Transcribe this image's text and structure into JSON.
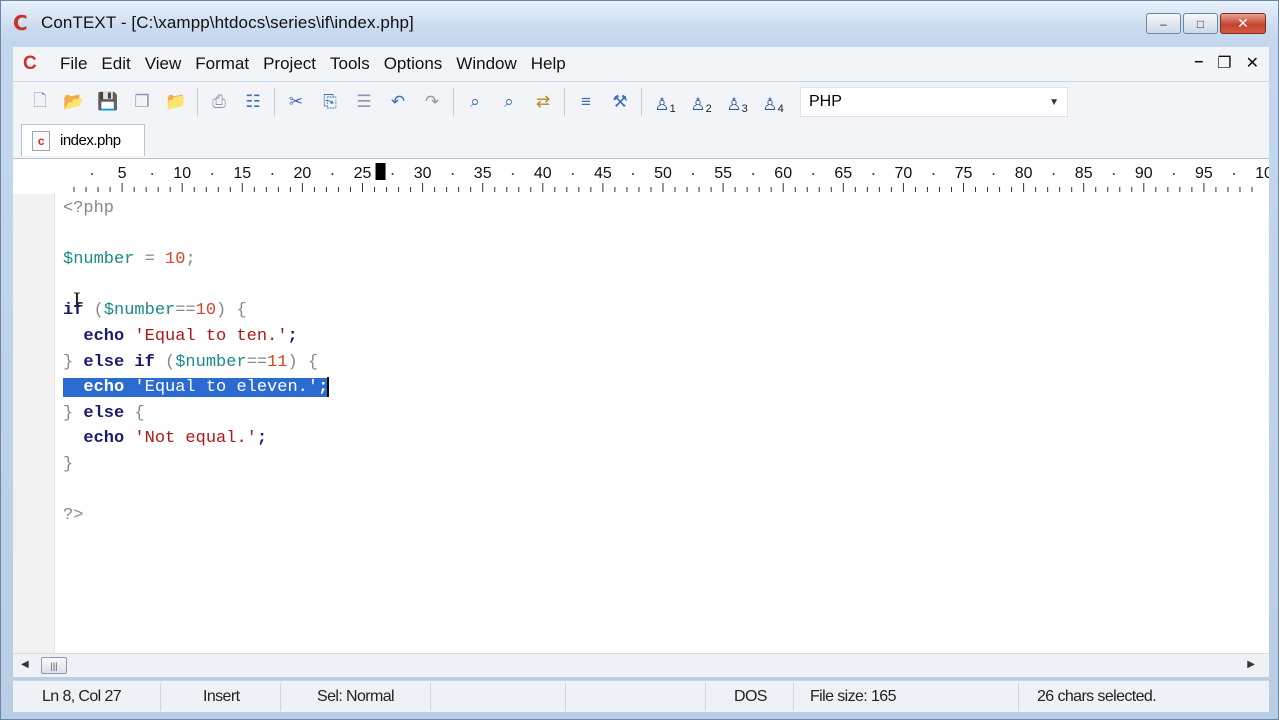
{
  "window": {
    "title": "ConTEXT - [C:\\xampp\\htdocs\\series\\if\\index.php]",
    "controls": {
      "minimize": "–",
      "maximize": "□",
      "close": "✕"
    }
  },
  "menu": {
    "items": [
      "File",
      "Edit",
      "View",
      "Format",
      "Project",
      "Tools",
      "Options",
      "Window",
      "Help"
    ],
    "mdi": {
      "minimize": "–",
      "restore": "❐",
      "close": "✕"
    }
  },
  "toolbar": {
    "buttons": [
      {
        "name": "new-file-icon",
        "glyph": "🗋"
      },
      {
        "name": "open-file-icon",
        "glyph": "📂"
      },
      {
        "name": "save-icon",
        "glyph": "💾"
      },
      {
        "name": "save-all-icon",
        "glyph": "❐"
      },
      {
        "name": "open-folder-icon",
        "glyph": "📁"
      },
      {
        "name": "print-icon",
        "glyph": "⎙"
      },
      {
        "name": "print-preview-icon",
        "glyph": "☷"
      },
      {
        "name": "cut-icon",
        "glyph": "✂"
      },
      {
        "name": "copy-icon",
        "glyph": "⎘"
      },
      {
        "name": "paste-icon",
        "glyph": "☰"
      },
      {
        "name": "undo-icon",
        "glyph": "↶"
      },
      {
        "name": "redo-icon",
        "glyph": "↷"
      },
      {
        "name": "find-icon",
        "glyph": "⌕"
      },
      {
        "name": "find-next-icon",
        "glyph": "⌕"
      },
      {
        "name": "replace-icon",
        "glyph": "⇄"
      },
      {
        "name": "file-info-icon",
        "glyph": "≡"
      },
      {
        "name": "tools-icon",
        "glyph": "⚒"
      }
    ],
    "bookmarks": [
      {
        "name": "bookmark-1-icon",
        "num": "1"
      },
      {
        "name": "bookmark-2-icon",
        "num": "2"
      },
      {
        "name": "bookmark-3-icon",
        "num": "3"
      },
      {
        "name": "bookmark-4-icon",
        "num": "4"
      }
    ],
    "language": "PHP"
  },
  "tabs": [
    {
      "label": "index.php"
    }
  ],
  "ruler": {
    "labels": [
      "5",
      "10",
      "15",
      "20",
      "25",
      "30",
      "35",
      "40",
      "45",
      "50",
      "55",
      "60",
      "65",
      "70",
      "75",
      "80",
      "85",
      "90",
      "95",
      "10"
    ],
    "cursor_column": 27
  },
  "editor": {
    "lines": [
      "<?php",
      "",
      "$number = 10;",
      "",
      "if ($number==10) {",
      "  echo 'Equal to ten.';",
      "} else if ($number==11) {",
      "  echo 'Equal to eleven.';",
      "} else {",
      "  echo 'Not equal.';",
      "}",
      "",
      "?>"
    ],
    "selected_line": 8,
    "selected_text": "echo 'Equal to eleven.';"
  },
  "status": {
    "position": "Ln 8, Col 27",
    "mode": "Insert",
    "selection_mode": "Sel: Normal",
    "line_endings": "DOS",
    "file_size": "File size: 165",
    "selection_info": "26 chars selected."
  }
}
